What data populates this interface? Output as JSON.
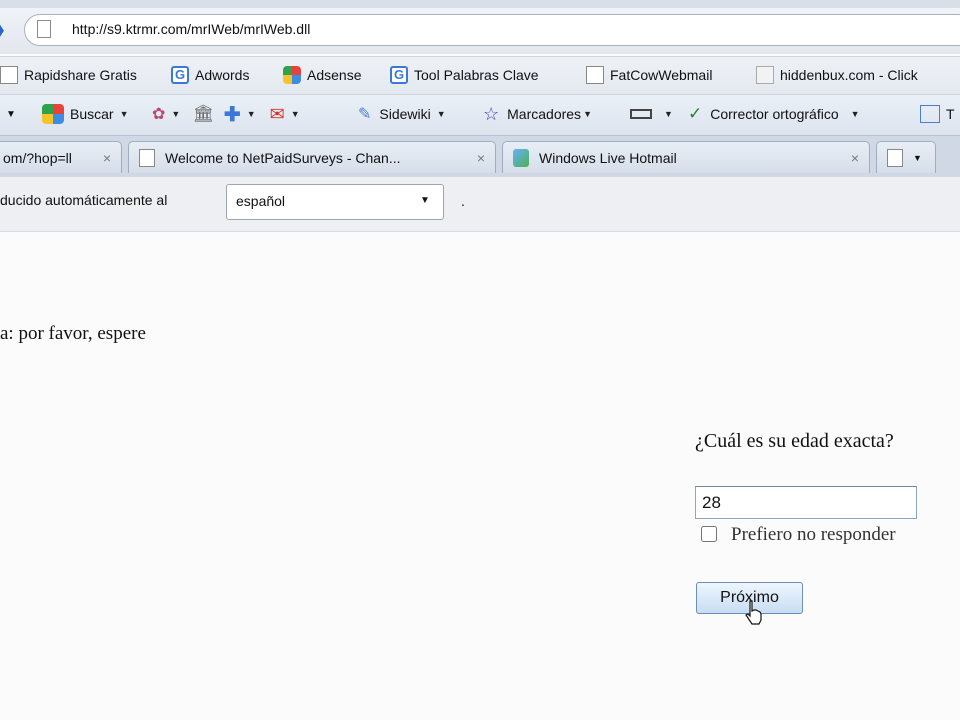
{
  "browser": {
    "url": "http://s9.ktrmr.com/mrIWeb/mrIWeb.dll",
    "bookmarks": [
      {
        "label": "Rapidshare Gratis",
        "icon": "document-icon"
      },
      {
        "label": "Adwords",
        "icon": "google-icon"
      },
      {
        "label": "Adsense",
        "icon": "adsense-icon"
      },
      {
        "label": "Tool Palabras Clave",
        "icon": "google-icon"
      },
      {
        "label": "FatCowWebmail",
        "icon": "document-icon"
      },
      {
        "label": "hiddenbux.com - Click",
        "icon": "hiddenbux-icon"
      }
    ],
    "toolbar": {
      "search_label": "Buscar",
      "sidewiki_label": "Sidewiki",
      "bookmarks_label": "Marcadores",
      "spellcheck_label": "Corrector ortográfico",
      "trailing_label": "T"
    },
    "tabs": [
      {
        "label": "om/?hop=ll",
        "icon": "none"
      },
      {
        "label": "Welcome to NetPaidSurveys - Chan...",
        "icon": "document-icon"
      },
      {
        "label": "Windows Live Hotmail",
        "icon": "windows-live-icon"
      }
    ],
    "translate_bar": {
      "text": "ducido automáticamente al",
      "language": "español",
      "trailing": "."
    }
  },
  "page": {
    "wait_text": "a: por favor, espere",
    "question": "¿Cuál es su edad exacta?",
    "age_value": "28",
    "no_answer_label": "Prefiero no responder",
    "next_label": "Próximo"
  },
  "colors": {
    "accent_blue": "#3b78d8",
    "button_border": "#6b8fb6",
    "chrome_bg": "#e2e7ee"
  }
}
